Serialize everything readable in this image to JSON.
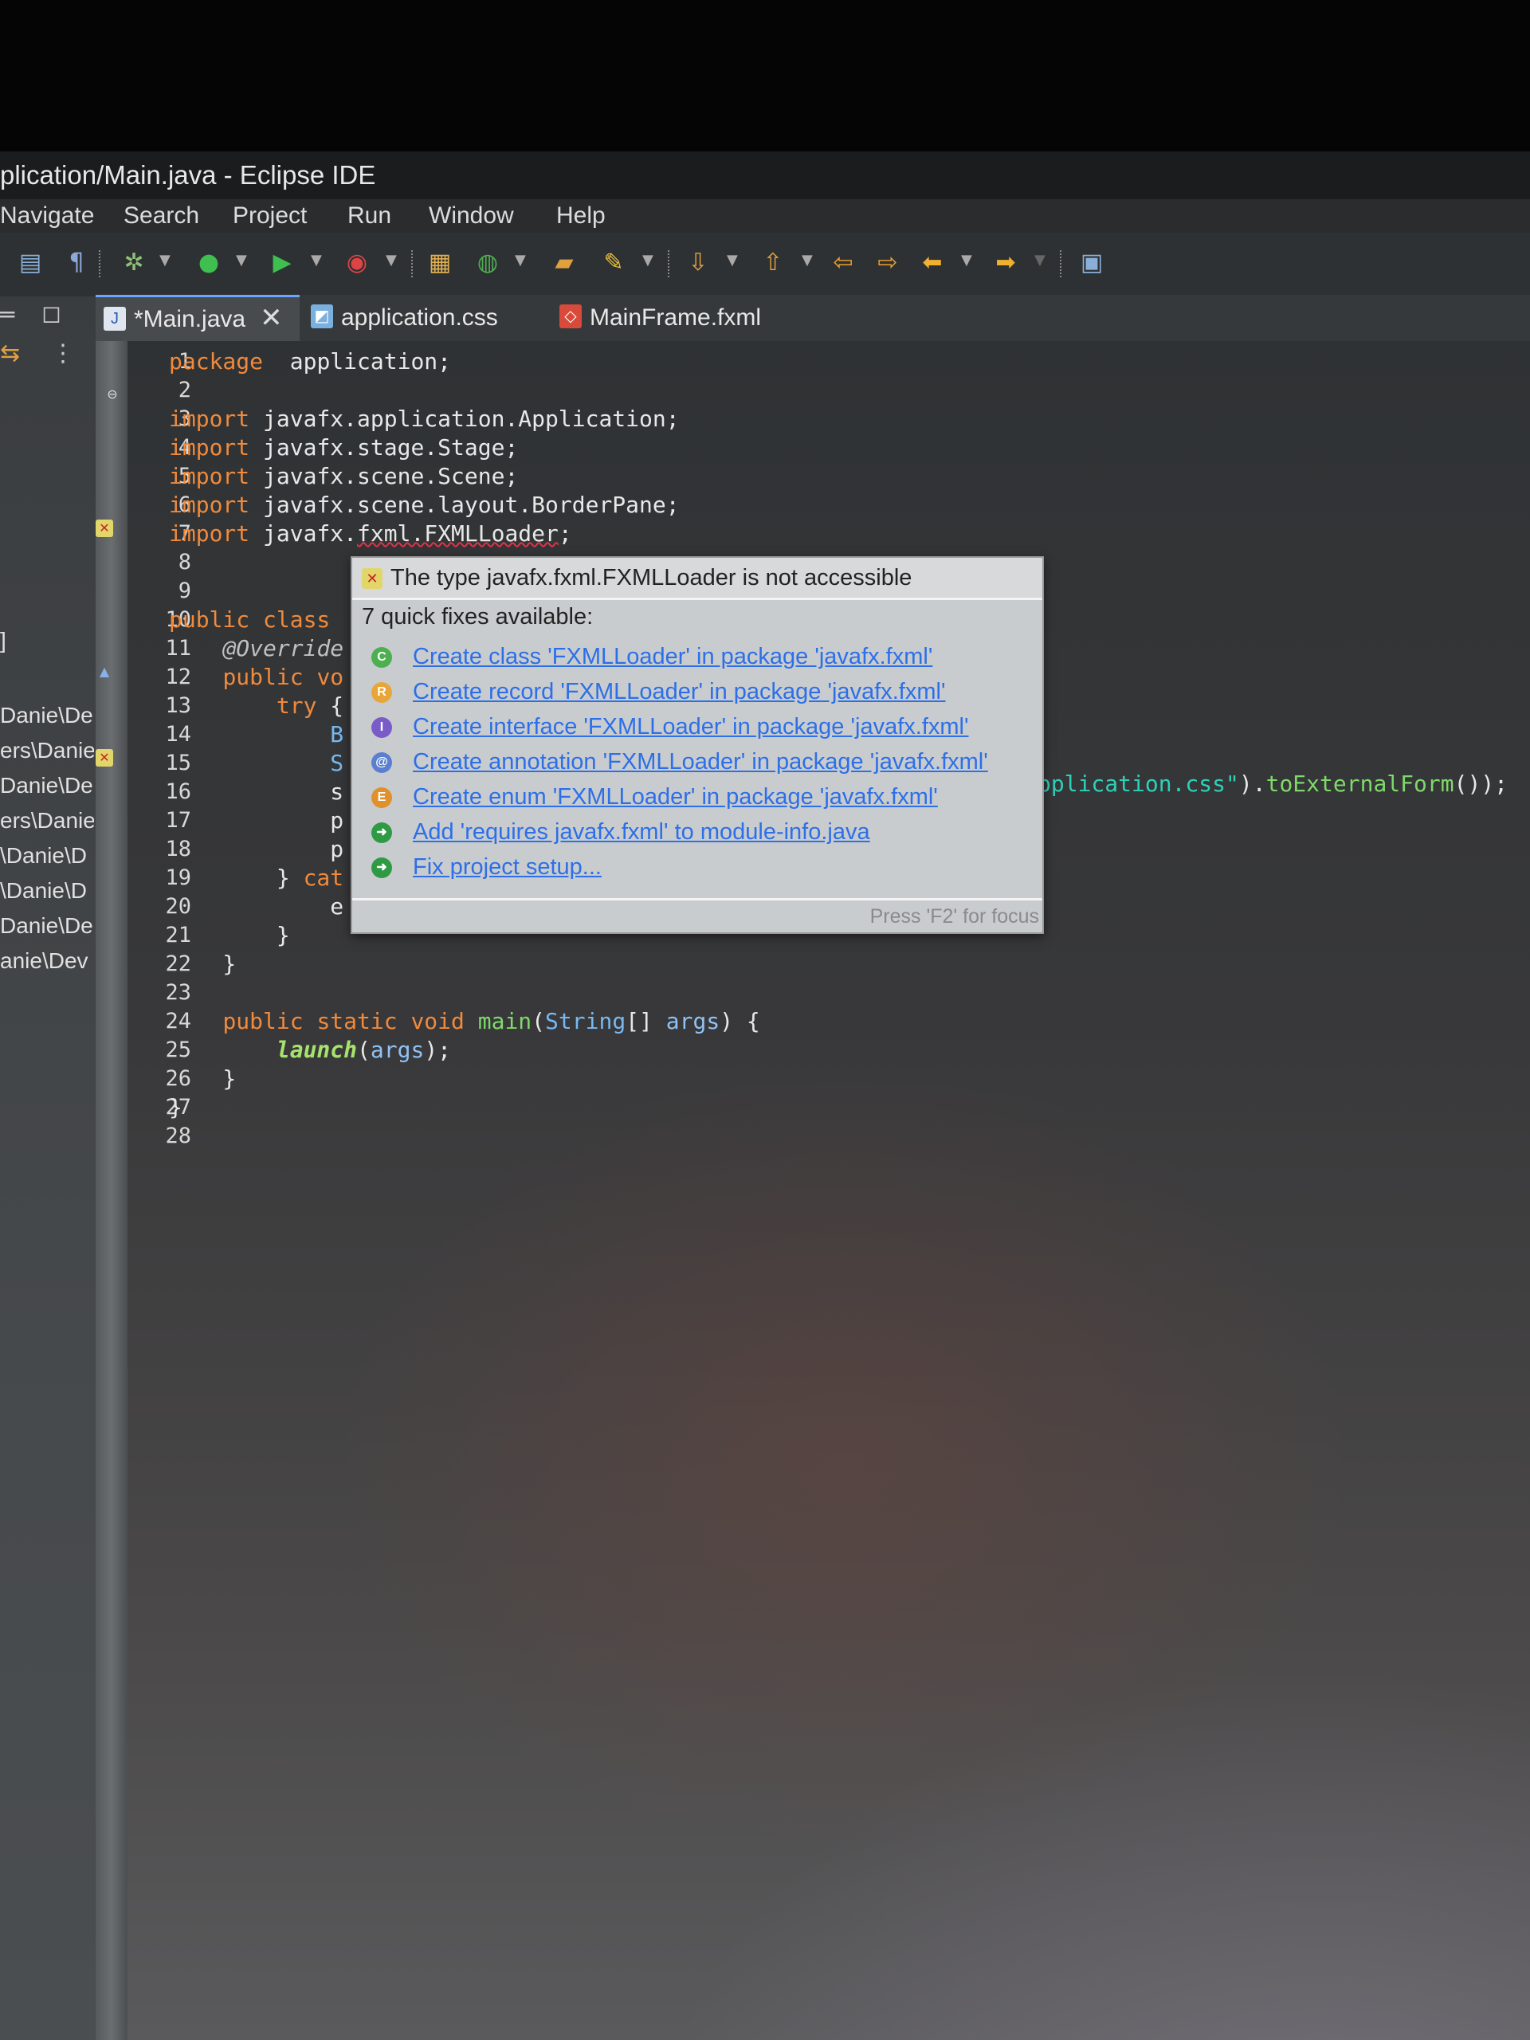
{
  "window": {
    "title": "plication/Main.java - Eclipse IDE"
  },
  "menu": [
    "Navigate",
    "Search",
    "Project",
    "Run",
    "Window",
    "Help"
  ],
  "tabs": [
    {
      "label": "*Main.java",
      "active": true,
      "close": "✕"
    },
    {
      "label": "application.css",
      "active": false
    },
    {
      "label": "MainFrame.fxml",
      "active": false
    }
  ],
  "explorer": {
    "items": [
      "Danie\\De",
      "ers\\Danie",
      "Danie\\De",
      "ers\\Danie",
      "\\Danie\\D",
      "\\Danie\\D",
      "Danie\\De",
      "anie\\Dev"
    ],
    "bracket": "]"
  },
  "code": {
    "lines": [
      {
        "n": "1",
        "tokens": [
          [
            "kw",
            "package"
          ],
          [
            "",
            "  application;"
          ]
        ]
      },
      {
        "n": "2",
        "tokens": []
      },
      {
        "n": "3",
        "tokens": [
          [
            "kw",
            "import"
          ],
          [
            "",
            " javafx.application.Application;"
          ]
        ]
      },
      {
        "n": "4",
        "tokens": [
          [
            "kw",
            "import"
          ],
          [
            "",
            " javafx.stage.Stage;"
          ]
        ]
      },
      {
        "n": "5",
        "tokens": [
          [
            "kw",
            "import"
          ],
          [
            "",
            " javafx.scene.Scene;"
          ]
        ]
      },
      {
        "n": "6",
        "tokens": [
          [
            "kw",
            "import"
          ],
          [
            "",
            " javafx.scene.layout.BorderPane;"
          ]
        ]
      },
      {
        "n": "7",
        "tokens": [
          [
            "kw",
            "import"
          ],
          [
            "",
            " javafx."
          ],
          [
            "err",
            "fxml.FXMLLoader"
          ],
          [
            "",
            ";"
          ]
        ]
      },
      {
        "n": "8",
        "tokens": []
      },
      {
        "n": "9",
        "tokens": []
      },
      {
        "n": "10",
        "tokens": [
          [
            "kw",
            "public class"
          ]
        ]
      },
      {
        "n": "11",
        "tokens": [
          [
            "",
            "    "
          ],
          [
            "ann",
            "@Override"
          ]
        ]
      },
      {
        "n": "12",
        "tokens": [
          [
            "",
            "    "
          ],
          [
            "kw",
            "public vo"
          ]
        ]
      },
      {
        "n": "13",
        "tokens": [
          [
            "",
            "        "
          ],
          [
            "kw",
            "try"
          ],
          [
            "",
            " {"
          ]
        ]
      },
      {
        "n": "14",
        "tokens": [
          [
            "",
            "            "
          ],
          [
            "ty",
            "B"
          ]
        ]
      },
      {
        "n": "15",
        "tokens": [
          [
            "",
            "            "
          ],
          [
            "ty",
            "S"
          ]
        ]
      },
      {
        "n": "16",
        "tokens": [
          [
            "",
            "            "
          ],
          [
            "",
            "s"
          ]
        ]
      },
      {
        "n": "17",
        "tokens": [
          [
            "",
            "            "
          ],
          [
            "",
            "p"
          ]
        ]
      },
      {
        "n": "18",
        "tokens": [
          [
            "",
            "            "
          ],
          [
            "",
            "p"
          ]
        ]
      },
      {
        "n": "19",
        "tokens": [
          [
            "",
            "        } "
          ],
          [
            "kw",
            "cat"
          ]
        ]
      },
      {
        "n": "20",
        "tokens": [
          [
            "",
            "            "
          ],
          [
            "",
            "e"
          ]
        ]
      },
      {
        "n": "21",
        "tokens": [
          [
            "",
            "        }"
          ]
        ]
      },
      {
        "n": "22",
        "tokens": [
          [
            "",
            "    }"
          ]
        ]
      },
      {
        "n": "23",
        "tokens": []
      },
      {
        "n": "24",
        "tokens": [
          [
            "",
            "    "
          ],
          [
            "kw",
            "public static void"
          ],
          [
            "",
            " "
          ],
          [
            "fn",
            "main"
          ],
          [
            "",
            "("
          ],
          [
            "ty",
            "String"
          ],
          [
            "",
            "[] "
          ],
          [
            "var",
            "args"
          ],
          [
            "",
            ") {"
          ]
        ]
      },
      {
        "n": "25",
        "tokens": [
          [
            "",
            "        "
          ],
          [
            "it",
            "launch"
          ],
          [
            "",
            "("
          ],
          [
            "var",
            "args"
          ],
          [
            "",
            ");"
          ]
        ]
      },
      {
        "n": "26",
        "tokens": [
          [
            "",
            "    }"
          ]
        ]
      },
      {
        "n": "27",
        "tokens": [
          [
            "",
            "}"
          ]
        ]
      },
      {
        "n": "28",
        "tokens": []
      }
    ],
    "line16_tail": [
      [
        "str",
        "pplication.css\""
      ],
      [
        "",
        ")."
      ],
      [
        "fn",
        "toExternalForm"
      ],
      [
        "",
        "());"
      ]
    ]
  },
  "hover": {
    "header": "The type javafx.fxml.FXMLLoader is not accessible",
    "quick_fixes_title": "7 quick fixes available:",
    "fixes": [
      {
        "icon": "C",
        "icon_name": "class-icon",
        "color": "#4caf50",
        "label": "Create class 'FXMLLoader' in package 'javafx.fxml'"
      },
      {
        "icon": "R",
        "icon_name": "record-icon",
        "color": "#e8a53a",
        "label": "Create record 'FXMLLoader' in package 'javafx.fxml'"
      },
      {
        "icon": "I",
        "icon_name": "interface-icon",
        "color": "#7a5cc8",
        "label": "Create interface 'FXMLLoader' in package 'javafx.fxml'"
      },
      {
        "icon": "@",
        "icon_name": "annotation-icon",
        "color": "#5b7fd0",
        "label": "Create annotation 'FXMLLoader' in package 'javafx.fxml'"
      },
      {
        "icon": "E",
        "icon_name": "enum-icon",
        "color": "#e0902c",
        "label": "Create enum 'FXMLLoader' in package 'javafx.fxml'"
      },
      {
        "icon": "➜",
        "icon_name": "change-icon",
        "color": "#2f9a44",
        "label": "Add 'requires javafx.fxml' to module-info.java"
      },
      {
        "icon": "➜",
        "icon_name": "change-icon",
        "color": "#2f9a44",
        "label": "Fix project setup..."
      }
    ],
    "footer": "Press 'F2' for focus"
  },
  "colors": {
    "keyword": "#f08a3c",
    "string": "#2fd0b8",
    "link": "#2c6fe8",
    "error": "#e0334a"
  }
}
